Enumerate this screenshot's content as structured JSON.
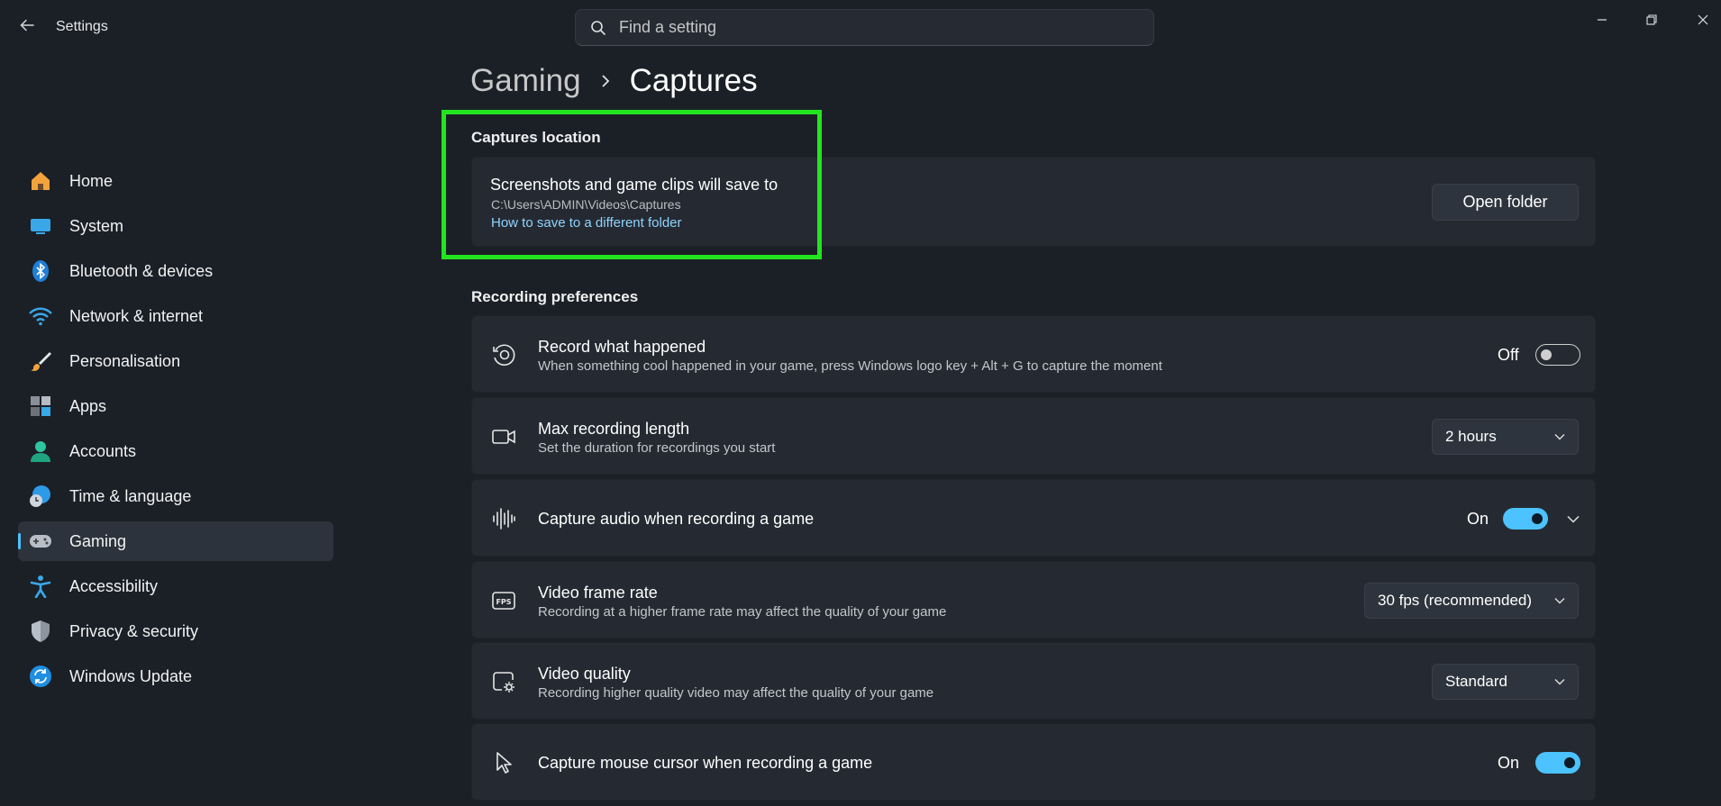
{
  "window": {
    "title": "Settings",
    "search_placeholder": "Find a setting"
  },
  "sidebar": {
    "items": [
      {
        "label": "Home",
        "icon": "home-icon"
      },
      {
        "label": "System",
        "icon": "system-icon"
      },
      {
        "label": "Bluetooth & devices",
        "icon": "bluetooth-icon"
      },
      {
        "label": "Network & internet",
        "icon": "wifi-icon"
      },
      {
        "label": "Personalisation",
        "icon": "brush-icon"
      },
      {
        "label": "Apps",
        "icon": "apps-icon"
      },
      {
        "label": "Accounts",
        "icon": "person-icon"
      },
      {
        "label": "Time & language",
        "icon": "globe-clock-icon"
      },
      {
        "label": "Gaming",
        "icon": "gamepad-icon",
        "active": true
      },
      {
        "label": "Accessibility",
        "icon": "accessibility-icon"
      },
      {
        "label": "Privacy & security",
        "icon": "shield-icon"
      },
      {
        "label": "Windows Update",
        "icon": "update-icon"
      }
    ]
  },
  "breadcrumb": {
    "parent": "Gaming",
    "current": "Captures"
  },
  "captures_location": {
    "heading": "Captures location",
    "title": "Screenshots and game clips will save to",
    "path": "C:\\Users\\ADMIN\\Videos\\Captures",
    "link": "How to save to a different folder",
    "button": "Open folder"
  },
  "recording": {
    "heading": "Recording preferences",
    "record_what_happened": {
      "title": "Record what happened",
      "desc": "When something cool happened in your game, press Windows logo key + Alt + G to capture the moment",
      "state": "Off"
    },
    "max_length": {
      "title": "Max recording length",
      "desc": "Set the duration for recordings you start",
      "value": "2 hours"
    },
    "capture_audio": {
      "title": "Capture audio when recording a game",
      "state": "On"
    },
    "frame_rate": {
      "title": "Video frame rate",
      "desc": "Recording at a higher frame rate may affect the quality of your game",
      "value": "30 fps (recommended)"
    },
    "video_quality": {
      "title": "Video quality",
      "desc": "Recording higher quality video may affect the quality of your game",
      "value": "Standard"
    },
    "mouse_cursor": {
      "title": "Capture mouse cursor when recording a game",
      "state": "On"
    }
  },
  "colors": {
    "accent": "#4cc2ff",
    "highlight": "#22e51f",
    "background": "#1b2027",
    "card": "#252a32"
  }
}
